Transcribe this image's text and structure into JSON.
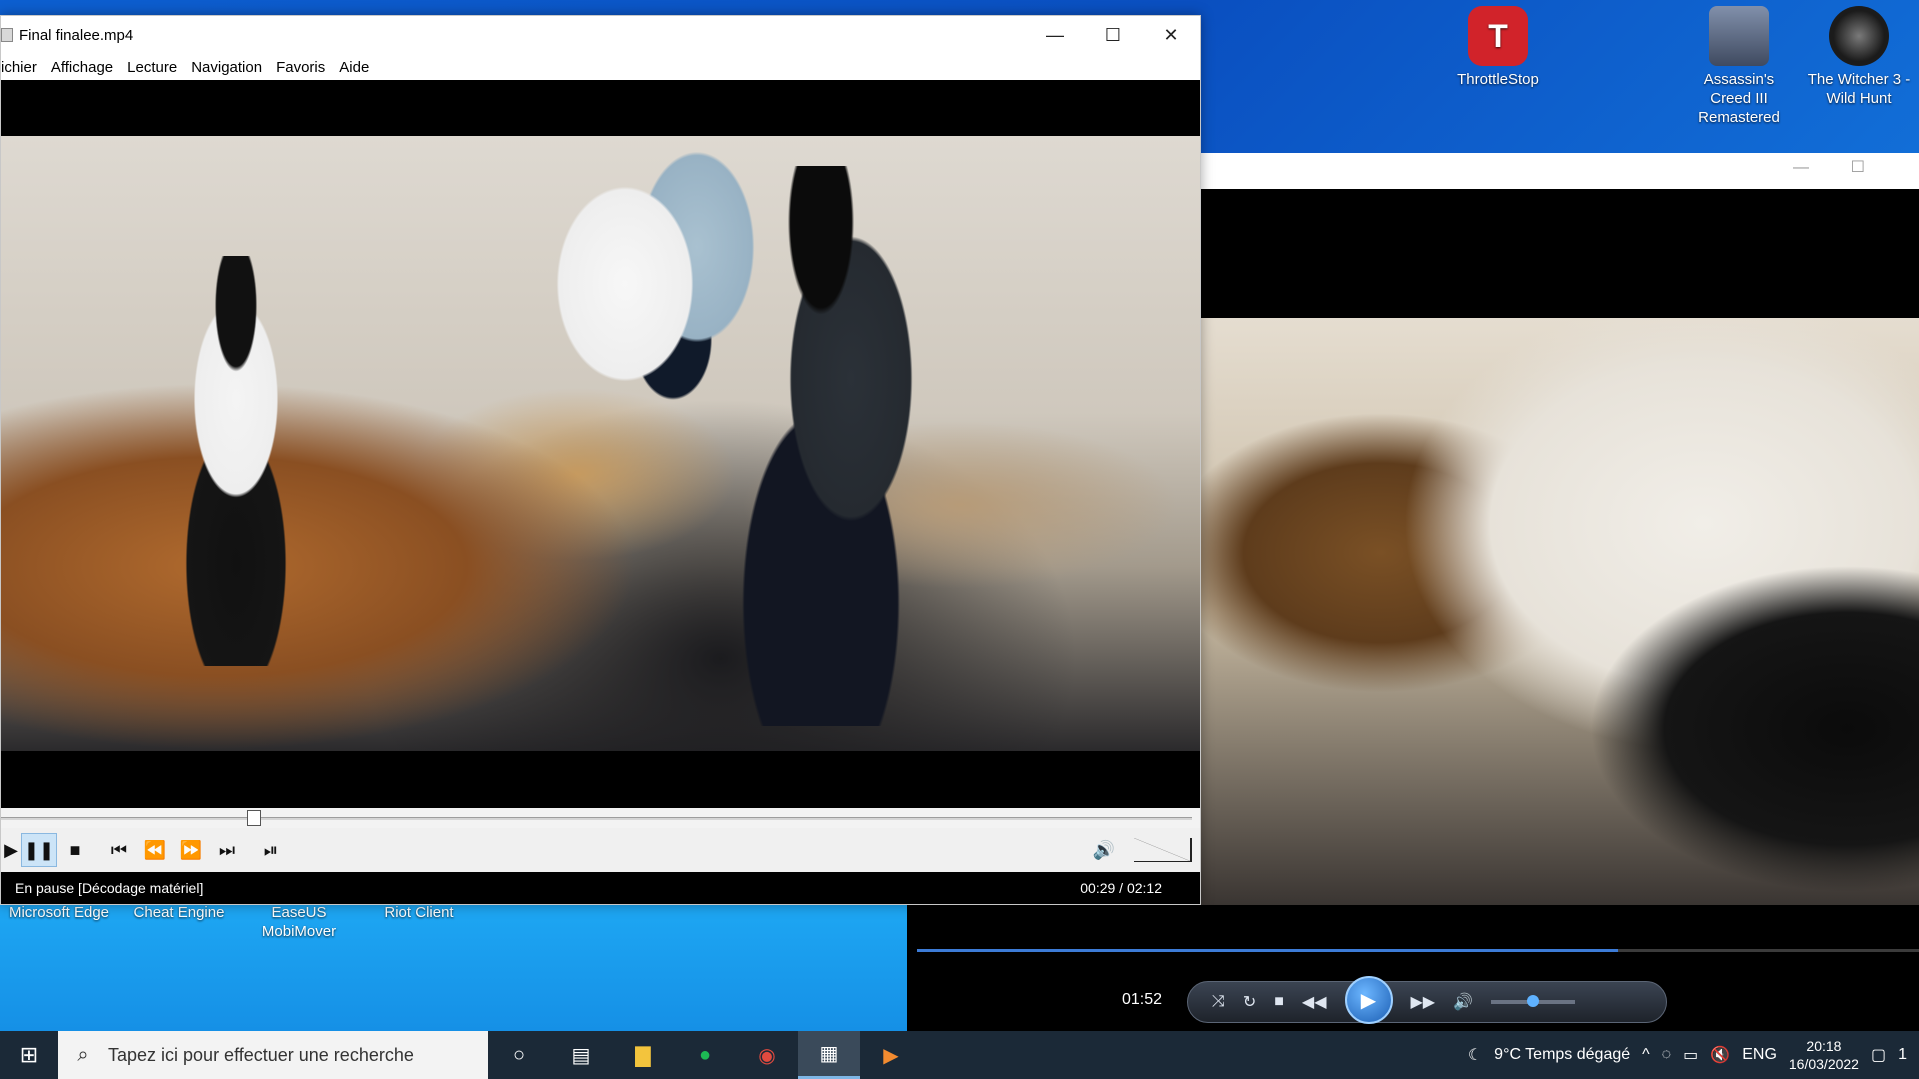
{
  "mpc": {
    "title": "Final finalee.mp4",
    "menu": [
      "ichier",
      "Affichage",
      "Lecture",
      "Navigation",
      "Favoris",
      "Aide"
    ],
    "progress_fraction": 0.22,
    "status": "En pause [Décodage matériel]",
    "time": "00:29 / 02:12"
  },
  "desktop": {
    "icons_top": [
      {
        "label": "ThrottleStop",
        "color": "#d1232a"
      },
      {
        "label": "Assassin's Creed III Remastered",
        "color": "#5a6a86"
      },
      {
        "label": "The Witcher 3 - Wild Hunt",
        "color": "#1c1c1c"
      }
    ],
    "icons_bottom": [
      {
        "label": "Microsoft Edge",
        "color": "#1b78d8"
      },
      {
        "label": "Cheat Engine",
        "color": "#2a6fb0"
      },
      {
        "label": "EaseUS MobiMover",
        "color": "#1f8ee6"
      },
      {
        "label": "Riot Client",
        "color": "#d13639"
      }
    ]
  },
  "player2": {
    "time": "01:52",
    "progress_fraction": 0.7,
    "volume_fraction": 0.43
  },
  "taskbar": {
    "search_placeholder": "Tapez ici pour effectuer une recherche",
    "weather": "9°C  Temps dégagé",
    "language": "ENG",
    "time": "20:18",
    "date": "16/03/2022",
    "notifications": "1"
  }
}
